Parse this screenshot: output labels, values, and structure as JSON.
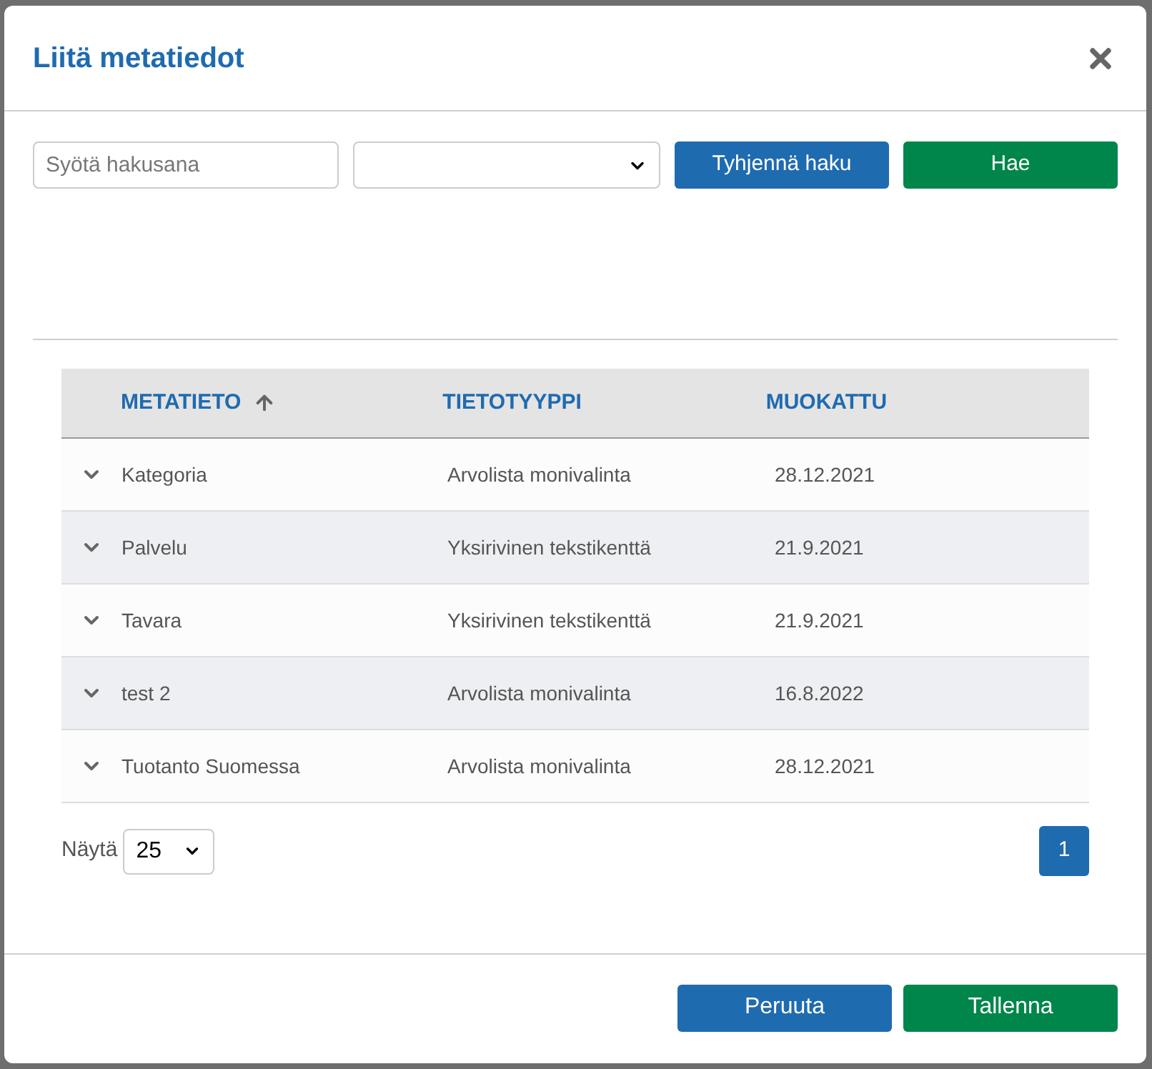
{
  "dialog": {
    "title": "Liitä metatiedot"
  },
  "filters": {
    "search": {
      "placeholder": "Syötä hakusana"
    },
    "buttons": [
      {
        "label": "Tyhjennä haku",
        "kind": "secondary"
      },
      {
        "label": "Hae",
        "kind": "primary"
      }
    ]
  },
  "table": {
    "columns": [
      {
        "label": "METATIETO",
        "sorted": true
      },
      {
        "label": "TIETOTYYPPI",
        "sorted": false
      },
      {
        "label": "MUOKATTU",
        "sorted": false
      }
    ],
    "rows": [
      {
        "name": "Kategoria",
        "type": "Arvolista monivalinta",
        "modified": "28.12.2021",
        "expanded": false
      },
      {
        "name": "Palvelu",
        "type": "Yksirivinen tekstikenttä",
        "modified": "21.9.2021",
        "expanded": false
      },
      {
        "name": "Tavara",
        "type": "Yksirivinen tekstikenttä",
        "modified": "21.9.2021",
        "expanded": false
      },
      {
        "name": "test 2",
        "type": "Arvolista monivalinta",
        "modified": "16.8.2022",
        "expanded": false
      },
      {
        "name": "Tuotanto Suomessa",
        "type": "Arvolista monivalinta",
        "modified": "28.12.2021",
        "expanded": false
      }
    ]
  },
  "pagination": {
    "show_label": "Näytä",
    "page_size": "25",
    "pages": [
      {
        "label": "1",
        "selected": true
      }
    ]
  },
  "footer": {
    "buttons": [
      {
        "label": "Peruuta",
        "kind": "secondary"
      },
      {
        "label": "Tallenna",
        "kind": "primary"
      }
    ]
  }
}
